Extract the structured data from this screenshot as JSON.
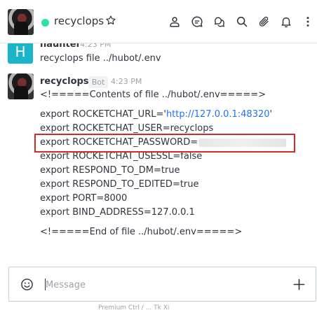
{
  "header": {
    "room_name": "recyclops",
    "status_color": "#2de0a5",
    "icons": [
      "star-icon",
      "members-icon",
      "discussion-icon",
      "threads-icon",
      "search-icon",
      "attachment-icon",
      "notifications-icon",
      "kebab-menu-icon"
    ]
  },
  "messages": [
    {
      "username": "haunter",
      "avatar_letter": "H",
      "avatar_color": "#1ab5c9",
      "time": "4:23 PM",
      "lines": [
        "recyclops file ../hubot/.env"
      ]
    },
    {
      "username": "recyclops",
      "badge": "Bot",
      "time": "4:23 PM",
      "header_line": "<!=====Contents of file ../hubot/.env=====>",
      "url_prefix": "export ROCKETCHAT_URL='",
      "url_link": "http://127.0.0.1:48320",
      "url_suffix": "'",
      "lines": [
        "export ROCKETCHAT_USER=recyclops",
        "export ROCKETCHAT_PASSWORD=",
        "export ROCKETCHAT_USESSL=false",
        "export RESPOND_TO_DM=true",
        "export RESPOND_TO_EDITED=true",
        "export PORT=8000",
        "export BIND_ADDRESS=127.0.0.1"
      ],
      "footer_line": "<!=====End of file ../hubot/.env=====>",
      "highlight_color": "#d22a2a"
    }
  ],
  "composer": {
    "placeholder": "Message"
  },
  "footer_hint": "Premium  Ctrl  /  ...  Tk  Xi"
}
